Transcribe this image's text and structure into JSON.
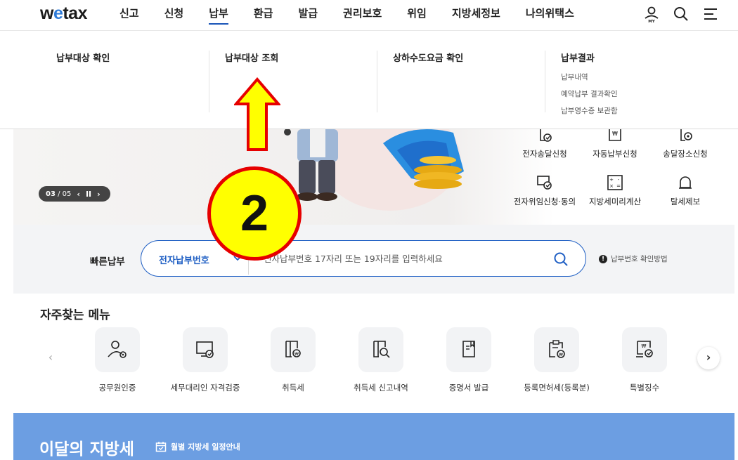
{
  "brand": {
    "logo_pre": "w",
    "logo_o": "e",
    "logo_post": "tax"
  },
  "nav": {
    "items": [
      "신고",
      "신청",
      "납부",
      "환급",
      "발급",
      "권리보호",
      "위임",
      "지방세정보",
      "나의위택스"
    ],
    "active": "납부",
    "my_badge": "MY"
  },
  "dropdown": {
    "col1": {
      "title": "납부대상 확인"
    },
    "col2": {
      "title": "납부대상 조회"
    },
    "col3": {
      "title": "상하수도요금 확인"
    },
    "col4": {
      "title": "납부결과",
      "subs": [
        "납부내역",
        "예약납부 결과확인",
        "납부영수증 보관함"
      ]
    }
  },
  "hero": {
    "slider": {
      "current": "03",
      "total": "/ 05",
      "prev": "‹",
      "pause": "II",
      "next": "›"
    },
    "quick": [
      {
        "label": "전자송달신청",
        "icon": "e-delivery-icon"
      },
      {
        "label": "자동납부신청",
        "icon": "auto-pay-icon"
      },
      {
        "label": "송달장소신청",
        "icon": "delivery-place-icon"
      },
      {
        "label": "전자위임신청·동의",
        "icon": "e-delegation-icon"
      },
      {
        "label": "지방세미리계산",
        "icon": "calculator-icon"
      },
      {
        "label": "탈세제보",
        "icon": "bell-icon"
      }
    ]
  },
  "fastpay": {
    "label": "빠른납부",
    "select_value": "전자납부번호",
    "placeholder": "전자납부번호 17자리 또는 19자리를 입력하세요",
    "help": "납부번호 확인방법",
    "help_mark": "!"
  },
  "favorites": {
    "title": "자주찾는 메뉴",
    "prev": "‹",
    "next": "›",
    "items": [
      {
        "label": "공무원인증",
        "icon": "official-cert-icon"
      },
      {
        "label": "세무대리인 자격검증",
        "icon": "tax-agent-verify-icon"
      },
      {
        "label": "취득세",
        "icon": "acquisition-tax-icon"
      },
      {
        "label": "취득세 신고내역",
        "icon": "acquisition-report-icon"
      },
      {
        "label": "증명서 발급",
        "icon": "certificate-icon"
      },
      {
        "label": "등록면허세(등록분)",
        "icon": "registration-tax-icon"
      },
      {
        "label": "특별징수",
        "icon": "special-collection-icon"
      }
    ]
  },
  "monthly": {
    "title": "이달의 지방세",
    "link": "월별 지방세 일정안내"
  },
  "annotation": {
    "number": "2"
  },
  "colors": {
    "accent": "#1f5fc4",
    "annotation_fill": "#ffff00",
    "annotation_stroke": "#e60000",
    "band": "#6c9ee2"
  }
}
